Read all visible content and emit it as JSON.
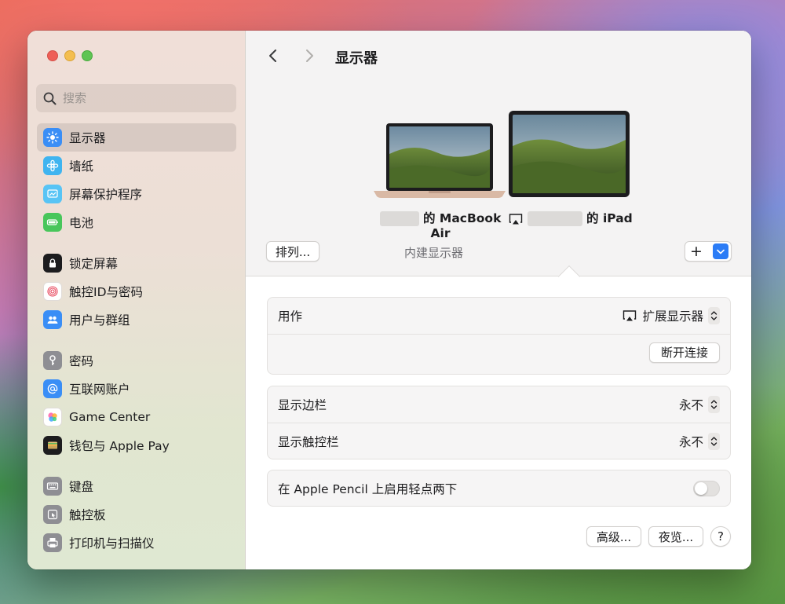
{
  "window": {
    "title": "显示器"
  },
  "search": {
    "placeholder": "搜索"
  },
  "sidebar": {
    "items": [
      {
        "label": "显示器",
        "icon": "display-icon",
        "color": "#3a8ef6",
        "active": true
      },
      {
        "label": "墙纸",
        "icon": "wallpaper-icon",
        "color": "#3fb4f0"
      },
      {
        "label": "屏幕保护程序",
        "icon": "screensaver-icon",
        "color": "#58c4f5"
      },
      {
        "label": "电池",
        "icon": "battery-icon",
        "color": "#48c65b"
      },
      {
        "label": "锁定屏幕",
        "icon": "lock-icon",
        "color": "#1c1c1e"
      },
      {
        "label": "触控ID与密码",
        "icon": "fingerprint-icon",
        "color": "#ffffff"
      },
      {
        "label": "用户与群组",
        "icon": "users-icon",
        "color": "#3a8ef6"
      },
      {
        "label": "密码",
        "icon": "key-icon",
        "color": "#8e8e93"
      },
      {
        "label": "互联网账户",
        "icon": "at-icon",
        "color": "#3a8ef6"
      },
      {
        "label": "Game Center",
        "icon": "game-center-icon",
        "color": "#ffffff"
      },
      {
        "label": "钱包与 Apple Pay",
        "icon": "wallet-icon",
        "color": "#1c1c1e"
      },
      {
        "label": "键盘",
        "icon": "keyboard-icon",
        "color": "#8e8e93"
      },
      {
        "label": "触控板",
        "icon": "trackpad-icon",
        "color": "#8e8e93"
      },
      {
        "label": "打印机与扫描仪",
        "icon": "printer-icon",
        "color": "#8e8e93"
      }
    ]
  },
  "displays": {
    "macbook": {
      "name_suffix": "的 MacBook",
      "name_line2": "Air",
      "sublabel": "内建显示器"
    },
    "ipad": {
      "name_suffix": "的 iPad"
    },
    "arrange_label": "排列...",
    "add_label": "+"
  },
  "settings": {
    "use_as": {
      "label": "用作",
      "value": "扩展显示器"
    },
    "disconnect_label": "断开连接",
    "show_sidebar": {
      "label": "显示边栏",
      "value": "永不"
    },
    "show_touchbar": {
      "label": "显示触控栏",
      "value": "永不"
    },
    "pencil": {
      "label": "在 Apple Pencil 上启用轻点两下",
      "enabled": false
    }
  },
  "footer": {
    "advanced_label": "高级...",
    "night_shift_label": "夜览...",
    "help_label": "?"
  }
}
